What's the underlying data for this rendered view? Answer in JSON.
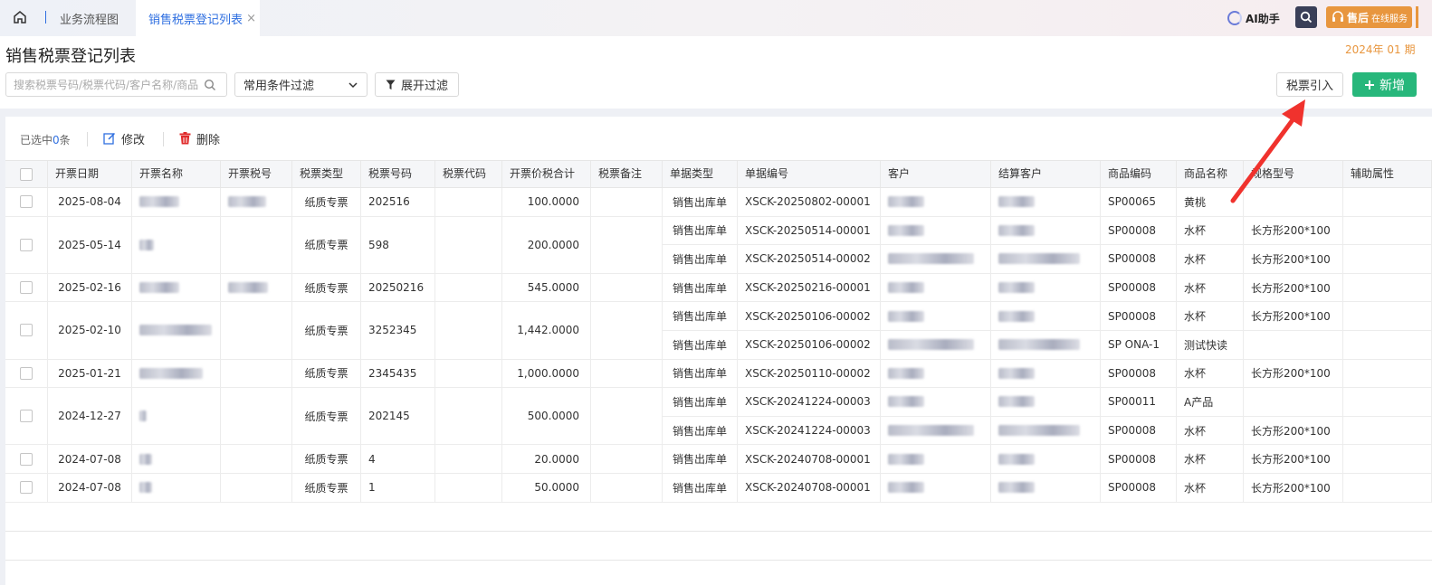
{
  "topbar": {
    "tabs": [
      {
        "label": "业务流程图",
        "active": false
      },
      {
        "label": "销售税票登记列表",
        "active": true,
        "close": "×"
      }
    ],
    "ai_label": "AI助手",
    "service_label": "售后",
    "service_sub": "在线服务"
  },
  "header": {
    "title": "销售税票登记列表",
    "period": "2024年 01 期"
  },
  "filters": {
    "search_placeholder": "搜索税票号码/税票代码/客户名称/商品",
    "common_filter": "常用条件过滤",
    "expand_filter": "展开过滤",
    "import_label": "税票引入",
    "new_label": "新增"
  },
  "toolbar": {
    "selected_prefix": "已选中",
    "selected_count": "0",
    "selected_suffix": "条",
    "edit_label": "修改",
    "delete_label": "删除"
  },
  "colors": {
    "primary": "#2f6fe0",
    "success": "#27b77b",
    "warning": "#e8963e",
    "danger": "#e02b2b"
  },
  "columns": [
    "开票日期",
    "开票名称",
    "开票税号",
    "税票类型",
    "税票号码",
    "税票代码",
    "开票价税合计",
    "税票备注",
    "单据类型",
    "单据编号",
    "客户",
    "结算客户",
    "商品编码",
    "商品名称",
    "规格型号",
    "辅助属性"
  ],
  "invoices": [
    {
      "date": "2025-08-04",
      "type": "纸质专票",
      "number": "202516",
      "total": "100.0000",
      "lines": [
        {
          "doc_type": "销售出库单",
          "doc_no": "XSCK-20250802-00001",
          "code": "SP00065",
          "name": "黄桃",
          "spec": ""
        }
      ]
    },
    {
      "date": "2025-05-14",
      "type": "纸质专票",
      "number": "598",
      "total": "200.0000",
      "lines": [
        {
          "doc_type": "销售出库单",
          "doc_no": "XSCK-20250514-00001",
          "code": "SP00008",
          "name": "水杯",
          "spec": "长方形200*100"
        },
        {
          "doc_type": "销售出库单",
          "doc_no": "XSCK-20250514-00002",
          "code": "SP00008",
          "name": "水杯",
          "spec": "长方形200*100"
        }
      ]
    },
    {
      "date": "2025-02-16",
      "type": "纸质专票",
      "number": "20250216",
      "total": "545.0000",
      "lines": [
        {
          "doc_type": "销售出库单",
          "doc_no": "XSCK-20250216-00001",
          "code": "SP00008",
          "name": "水杯",
          "spec": "长方形200*100"
        }
      ]
    },
    {
      "date": "2025-02-10",
      "type": "纸质专票",
      "number": "3252345",
      "total": "1,442.0000",
      "lines": [
        {
          "doc_type": "销售出库单",
          "doc_no": "XSCK-20250106-00002",
          "code": "SP00008",
          "name": "水杯",
          "spec": "长方形200*100"
        },
        {
          "doc_type": "销售出库单",
          "doc_no": "XSCK-20250106-00002",
          "code": "SP ONA-1",
          "name": "测试快读",
          "spec": ""
        }
      ]
    },
    {
      "date": "2025-01-21",
      "type": "纸质专票",
      "number": "2345435",
      "total": "1,000.0000",
      "lines": [
        {
          "doc_type": "销售出库单",
          "doc_no": "XSCK-20250110-00002",
          "code": "SP00008",
          "name": "水杯",
          "spec": "长方形200*100"
        }
      ]
    },
    {
      "date": "2024-12-27",
      "type": "纸质专票",
      "number": "202145",
      "total": "500.0000",
      "lines": [
        {
          "doc_type": "销售出库单",
          "doc_no": "XSCK-20241224-00003",
          "code": "SP00011",
          "name": "A产品",
          "spec": ""
        },
        {
          "doc_type": "销售出库单",
          "doc_no": "XSCK-20241224-00003",
          "code": "SP00008",
          "name": "水杯",
          "spec": "长方形200*100"
        }
      ]
    },
    {
      "date": "2024-07-08",
      "type": "纸质专票",
      "number": "4",
      "total": "20.0000",
      "lines": [
        {
          "doc_type": "销售出库单",
          "doc_no": "XSCK-20240708-00001",
          "code": "SP00008",
          "name": "水杯",
          "spec": "长方形200*100"
        }
      ]
    },
    {
      "date": "2024-07-08",
      "type": "纸质专票",
      "number": "1",
      "total": "50.0000",
      "lines": [
        {
          "doc_type": "销售出库单",
          "doc_no": "XSCK-20240708-00001",
          "code": "SP00008",
          "name": "水杯",
          "spec": "长方形200*100"
        }
      ]
    }
  ]
}
